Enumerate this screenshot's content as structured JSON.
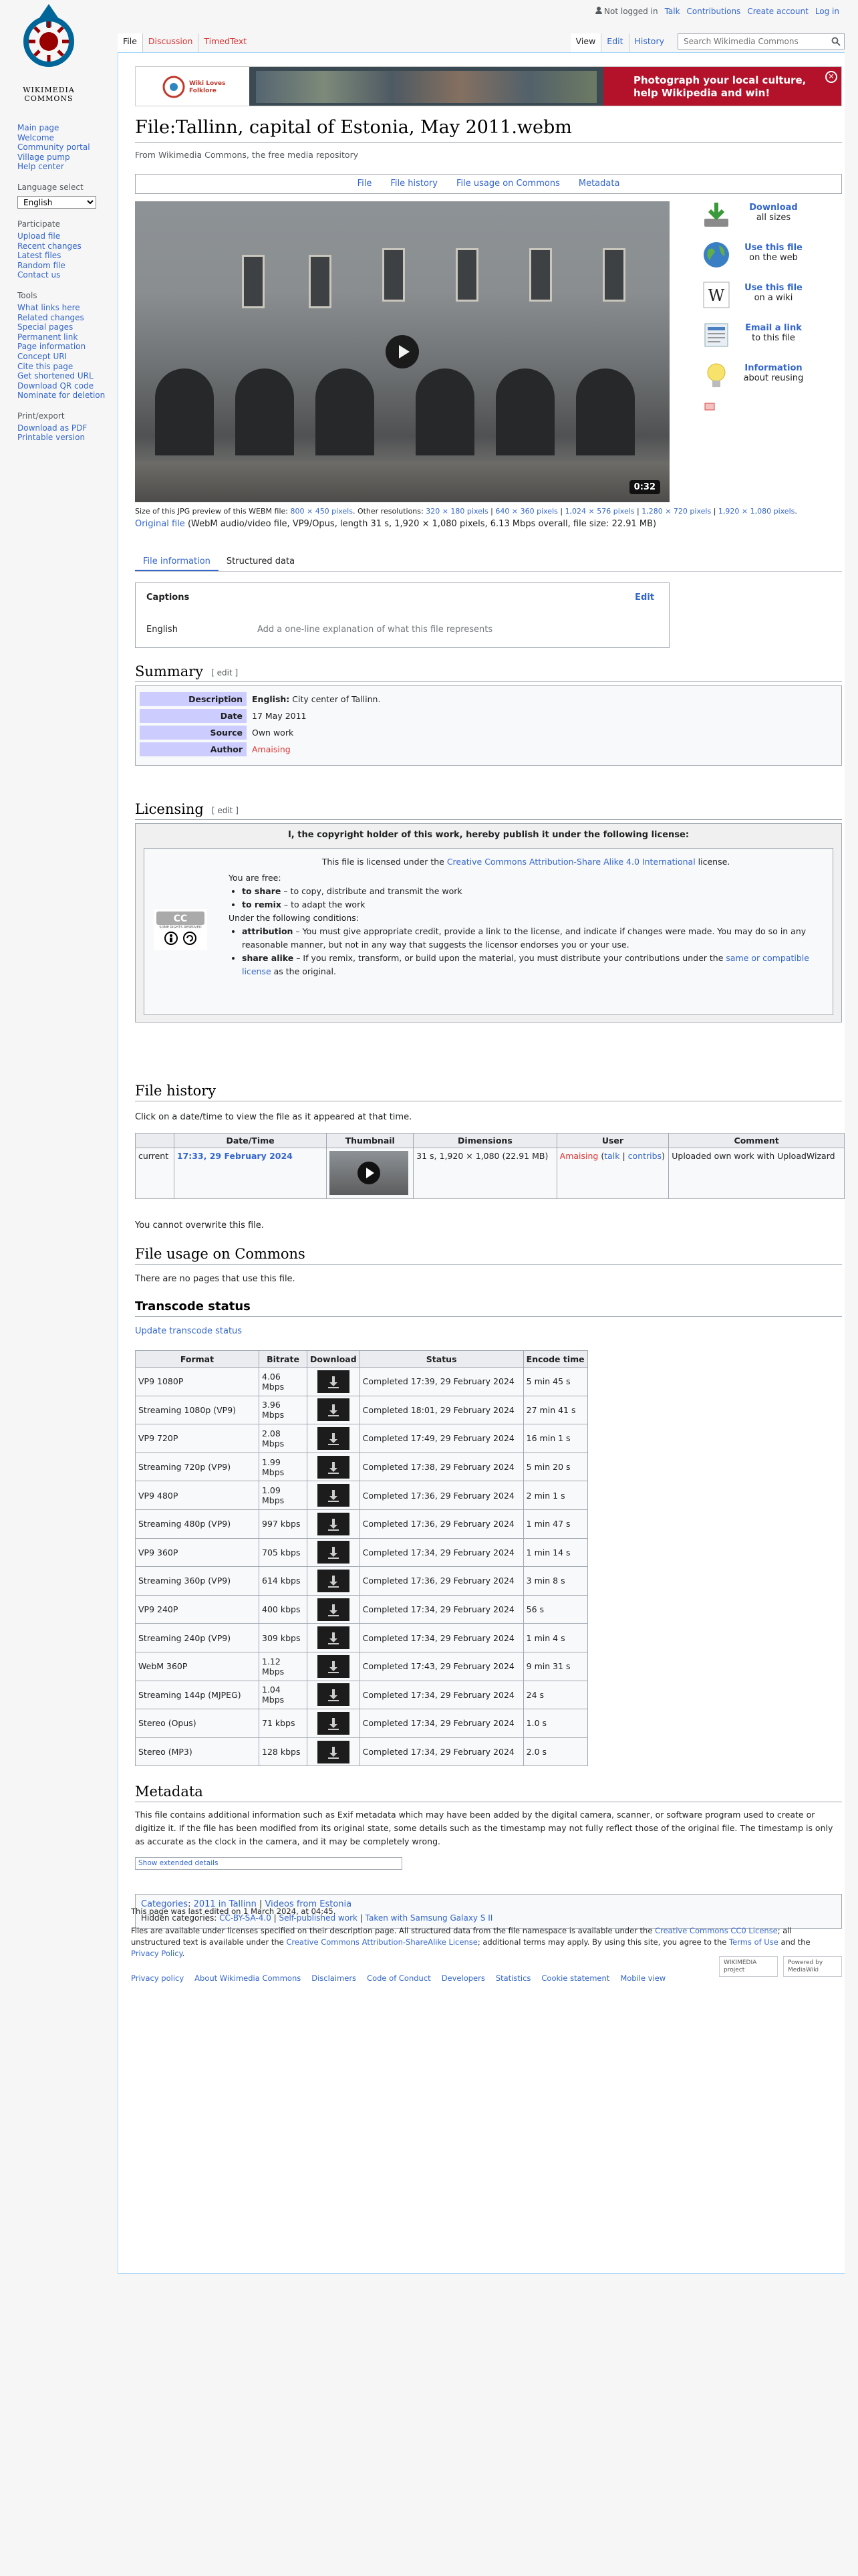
{
  "logo": {
    "line1": "WIKIMEDIA",
    "line2": "COMMONS"
  },
  "personal": {
    "not_logged_in": "Not logged in",
    "talk": "Talk",
    "contributions": "Contributions",
    "create_account": "Create account",
    "login": "Log in"
  },
  "tabs": {
    "file": "File",
    "discussion": "Discussion",
    "timedtext": "TimedText",
    "view": "View",
    "edit": "Edit",
    "history": "History"
  },
  "search": {
    "placeholder": "Search Wikimedia Commons"
  },
  "sidebar": {
    "nav": [
      "Main page",
      "Welcome",
      "Community portal",
      "Village pump",
      "Help center"
    ],
    "language_heading": "Language select",
    "language_value": "English",
    "participate_heading": "Participate",
    "participate": [
      "Upload file",
      "Recent changes",
      "Latest files",
      "Random file",
      "Contact us"
    ],
    "tools_heading": "Tools",
    "tools": [
      "What links here",
      "Related changes",
      "Special pages",
      "Permanent link",
      "Page information",
      "Concept URI",
      "Cite this page",
      "Get shortened URL",
      "Download QR code",
      "Nominate for deletion"
    ],
    "print_heading": "Print/export",
    "print": [
      "Download as PDF",
      "Printable version"
    ]
  },
  "banner": {
    "logo_text": "Wiki Loves Folklore",
    "text1": "Photograph your local culture,",
    "text2": "help Wikipedia and win!",
    "close": "✕"
  },
  "page": {
    "title": "File:Tallinn, capital of Estonia, May 2011.webm",
    "tagline": "From Wikimedia Commons, the free media repository"
  },
  "filetoc": [
    "File",
    "File history",
    "File usage on Commons",
    "Metadata"
  ],
  "player": {
    "duration": "0:32"
  },
  "actions": [
    {
      "title": "Download",
      "sub": "all sizes"
    },
    {
      "title": "Use this file",
      "sub": "on the web"
    },
    {
      "title": "Use this file",
      "sub": "on a wiki"
    },
    {
      "title": "Email a link",
      "sub": "to this file"
    },
    {
      "title": "Information",
      "sub": "about reusing"
    }
  ],
  "sizeinfo": {
    "prefix": "Size of this JPG preview of this WEBM file: ",
    "preview": "800 × 450 pixels",
    "other": ". Other resolutions: ",
    "res": [
      "320 × 180 pixels",
      "640 × 360 pixels",
      "1,024 × 576 pixels",
      "1,280 × 720 pixels",
      "1,920 × 1,080 pixels"
    ]
  },
  "original": {
    "link": "Original file",
    "info": " (WebM audio/video file, VP9/Opus, length 31 s, 1,920 × 1,080 pixels, 6.13 Mbps overall, file size: 22.91 MB)"
  },
  "mtabs": {
    "info": "File information",
    "structured": "Structured data"
  },
  "captions": {
    "title": "Captions",
    "edit": "Edit",
    "lang": "English",
    "placeholder": "Add a one-line explanation of what this file represents"
  },
  "summary": {
    "heading": "Summary",
    "edit": "[ edit ]",
    "rows": [
      {
        "k": "Description",
        "v_bold": "English:",
        "v": " City center of Tallinn."
      },
      {
        "k": "Date",
        "v": "17 May 2011"
      },
      {
        "k": "Source",
        "v": "Own work"
      },
      {
        "k": "Author",
        "v": "Amaising"
      }
    ]
  },
  "licensing": {
    "heading": "Licensing",
    "edit": "[ edit ]",
    "head": "I, the copyright holder of this work, hereby publish it under the following license:",
    "lic_pre": "This file is licensed under the ",
    "lic_link": "Creative Commons Attribution-Share Alike 4.0 International",
    "lic_post": " license.",
    "free": "You are free:",
    "share_b": "to share",
    "share": " – to copy, distribute and transmit the work",
    "remix_b": "to remix",
    "remix": " – to adapt the work",
    "cond": "Under the following conditions:",
    "attr_b": "attribution",
    "attr": " – You must give appropriate credit, provide a link to the license, and indicate if changes were made. You may do so in any reasonable manner, but not in any way that suggests the licensor endorses you or your use.",
    "sa_b": "share alike",
    "sa": " – If you remix, transform, or build upon the material, you must distribute your contributions under the ",
    "sa_link": "same or compatible license",
    "sa_post": " as the original.",
    "cc_text": "SOME RIGHTS RESERVED"
  },
  "history": {
    "heading": "File history",
    "text": "Click on a date/time to view the file as it appeared at that time.",
    "cols": [
      "",
      "Date/Time",
      "Thumbnail",
      "Dimensions",
      "User",
      "Comment"
    ],
    "current": "current",
    "date": "17:33, 29 February 2024",
    "dims": "31 s, 1,920 × 1,080 (22.91 MB)",
    "user": "Amaising",
    "talk": "talk",
    "contribs": "contribs",
    "comment": "Uploaded own work with UploadWizard",
    "overwrite": "You cannot overwrite this file."
  },
  "usage": {
    "heading": "File usage on Commons",
    "text": "There are no pages that use this file."
  },
  "transcode": {
    "heading": "Transcode status",
    "update": "Update transcode status",
    "cols": [
      "Format",
      "Bitrate",
      "Download",
      "Status",
      "Encode time"
    ],
    "rows": [
      [
        "VP9 1080P",
        "4.06 Mbps",
        "Completed 17:39, 29 February 2024",
        "5 min 45 s"
      ],
      [
        "Streaming 1080p (VP9)",
        "3.96 Mbps",
        "Completed 18:01, 29 February 2024",
        "27 min 41 s"
      ],
      [
        "VP9 720P",
        "2.08 Mbps",
        "Completed 17:49, 29 February 2024",
        "16 min 1 s"
      ],
      [
        "Streaming 720p (VP9)",
        "1.99 Mbps",
        "Completed 17:38, 29 February 2024",
        "5 min 20 s"
      ],
      [
        "VP9 480P",
        "1.09 Mbps",
        "Completed 17:36, 29 February 2024",
        "2 min 1 s"
      ],
      [
        "Streaming 480p (VP9)",
        "997 kbps",
        "Completed 17:36, 29 February 2024",
        "1 min 47 s"
      ],
      [
        "VP9 360P",
        "705 kbps",
        "Completed 17:34, 29 February 2024",
        "1 min 14 s"
      ],
      [
        "Streaming 360p (VP9)",
        "614 kbps",
        "Completed 17:36, 29 February 2024",
        "3 min 8 s"
      ],
      [
        "VP9 240P",
        "400 kbps",
        "Completed 17:34, 29 February 2024",
        "56 s"
      ],
      [
        "Streaming 240p (VP9)",
        "309 kbps",
        "Completed 17:34, 29 February 2024",
        "1 min 4 s"
      ],
      [
        "WebM 360P",
        "1.12 Mbps",
        "Completed 17:43, 29 February 2024",
        "9 min 31 s"
      ],
      [
        "Streaming 144p (MJPEG)",
        "1.04 Mbps",
        "Completed 17:34, 29 February 2024",
        "24 s"
      ],
      [
        "Stereo (Opus)",
        "71 kbps",
        "Completed 17:34, 29 February 2024",
        "1.0 s"
      ],
      [
        "Stereo (MP3)",
        "128 kbps",
        "Completed 17:34, 29 February 2024",
        "2.0 s"
      ]
    ]
  },
  "metadata": {
    "heading": "Metadata",
    "text": "This file contains additional information such as Exif metadata which may have been added by the digital camera, scanner, or software program used to create or digitize it. If the file has been modified from its original state, some details such as the timestamp may not fully reflect those of the original file. The timestamp is only as accurate as the clock in the camera, and it may be completely wrong.",
    "show": "Show extended details"
  },
  "categories": {
    "label": "Categories",
    "items": [
      "2011 in Tallinn",
      "Videos from Estonia"
    ],
    "hidden_label": "Hidden categories: ",
    "hidden": [
      "CC-BY-SA-4.0",
      "Self-published work",
      "Taken with Samsung Galaxy S II"
    ]
  },
  "footer": {
    "edited": "This page was last edited on 1 March 2024, at 04:45.",
    "lic1": "Files are available under licenses specified on their description page. All structured data from the file namespace is available under the ",
    "cc0": "Creative Commons CC0 License",
    "lic2": "; all unstructured text is available under the ",
    "ccbysa": "Creative Commons Attribution-ShareAlike License",
    "lic3": "; additional terms may apply. By using this site, you agree to the ",
    "terms": "Terms of Use",
    "and": " and the ",
    "privacy": "Privacy Policy",
    "dot": ".",
    "links": [
      "Privacy policy",
      "About Wikimedia Commons",
      "Disclaimers",
      "Code of Conduct",
      "Developers",
      "Statistics",
      "Cookie statement",
      "Mobile view"
    ],
    "badge1": "WIKIMEDIA project",
    "badge2": "Powered by MediaWiki"
  }
}
